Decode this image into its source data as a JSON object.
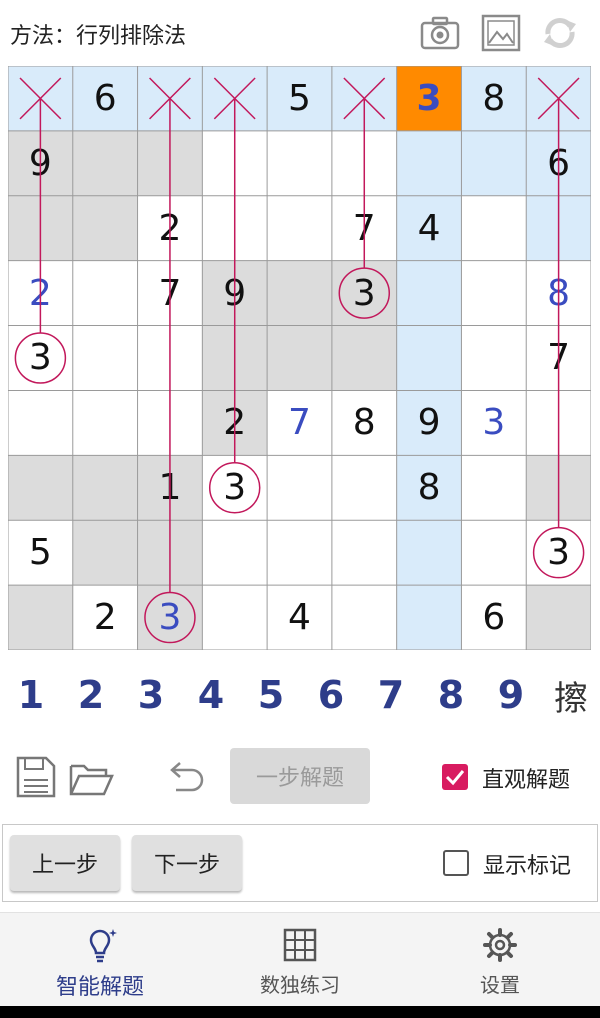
{
  "header": {
    "method_label": "方法：行列排除法",
    "icons": [
      "camera-icon",
      "gallery-icon",
      "refresh-icon"
    ]
  },
  "board": {
    "cells": [
      [
        "X",
        "6",
        "X",
        "X",
        "5",
        "X",
        "3",
        "8",
        "X"
      ],
      [
        "9",
        "",
        "",
        "",
        "",
        "",
        "",
        "",
        "6"
      ],
      [
        "",
        "",
        "2",
        "",
        "",
        "7",
        "4",
        "",
        ""
      ],
      [
        "2",
        "",
        "7",
        "9",
        "",
        "3",
        "",
        "",
        "8"
      ],
      [
        "3",
        "",
        "",
        "",
        "",
        "",
        "",
        "",
        "7"
      ],
      [
        "",
        "",
        "",
        "2",
        "7",
        "8",
        "9",
        "3",
        ""
      ],
      [
        "",
        "",
        "1",
        "3",
        "",
        "",
        "8",
        "",
        ""
      ],
      [
        "5",
        "",
        "",
        "",
        "",
        "",
        "",
        "",
        "3"
      ],
      [
        "",
        "2",
        "3",
        "",
        "4",
        "",
        "",
        "6",
        ""
      ]
    ],
    "highlights": {
      "orange": [
        [
          0,
          6
        ]
      ],
      "light": [
        [
          0,
          0
        ],
        [
          0,
          1
        ],
        [
          0,
          2
        ],
        [
          0,
          3
        ],
        [
          0,
          4
        ],
        [
          0,
          5
        ],
        [
          0,
          7
        ],
        [
          0,
          8
        ],
        [
          1,
          6
        ],
        [
          1,
          7
        ],
        [
          1,
          8
        ],
        [
          2,
          6
        ],
        [
          2,
          8
        ],
        [
          3,
          6
        ],
        [
          4,
          6
        ],
        [
          5,
          6
        ],
        [
          6,
          6
        ],
        [
          7,
          6
        ],
        [
          8,
          6
        ]
      ],
      "gray": [
        [
          1,
          0
        ],
        [
          1,
          1
        ],
        [
          1,
          2
        ],
        [
          2,
          0
        ],
        [
          2,
          1
        ],
        [
          3,
          3
        ],
        [
          3,
          4
        ],
        [
          3,
          5
        ],
        [
          4,
          3
        ],
        [
          4,
          4
        ],
        [
          4,
          5
        ],
        [
          5,
          3
        ],
        [
          6,
          0
        ],
        [
          6,
          1
        ],
        [
          6,
          2
        ],
        [
          6,
          8
        ],
        [
          7,
          1
        ],
        [
          7,
          2
        ],
        [
          8,
          0
        ],
        [
          8,
          2
        ],
        [
          8,
          8
        ]
      ]
    },
    "blue_cells": [
      [
        0,
        6
      ],
      [
        3,
        0
      ],
      [
        3,
        8
      ],
      [
        5,
        4
      ],
      [
        5,
        7
      ],
      [
        8,
        2
      ]
    ],
    "circled": [
      [
        3,
        5
      ],
      [
        4,
        0
      ],
      [
        6,
        3
      ],
      [
        7,
        8
      ],
      [
        8,
        2
      ]
    ],
    "elimination_columns": [
      0,
      2,
      3,
      5,
      8
    ],
    "elimination_color": "#c2185b"
  },
  "numpad": {
    "keys": [
      "1",
      "2",
      "3",
      "4",
      "5",
      "6",
      "7",
      "8",
      "9"
    ],
    "erase_label": "擦"
  },
  "toolbar": {
    "step_solve_label": "一步解题",
    "intuitive_label": "直观解题",
    "intuitive_checked": true,
    "accent_color": "#d81b60"
  },
  "steps": {
    "prev_label": "上一步",
    "next_label": "下一步",
    "show_marks_label": "显示标记",
    "show_marks_checked": false
  },
  "nav": {
    "items": [
      {
        "label": "智能解题",
        "icon": "bulb-icon",
        "active": true
      },
      {
        "label": "数独练习",
        "icon": "grid-icon",
        "active": false
      },
      {
        "label": "设置",
        "icon": "gear-icon",
        "active": false
      }
    ]
  }
}
